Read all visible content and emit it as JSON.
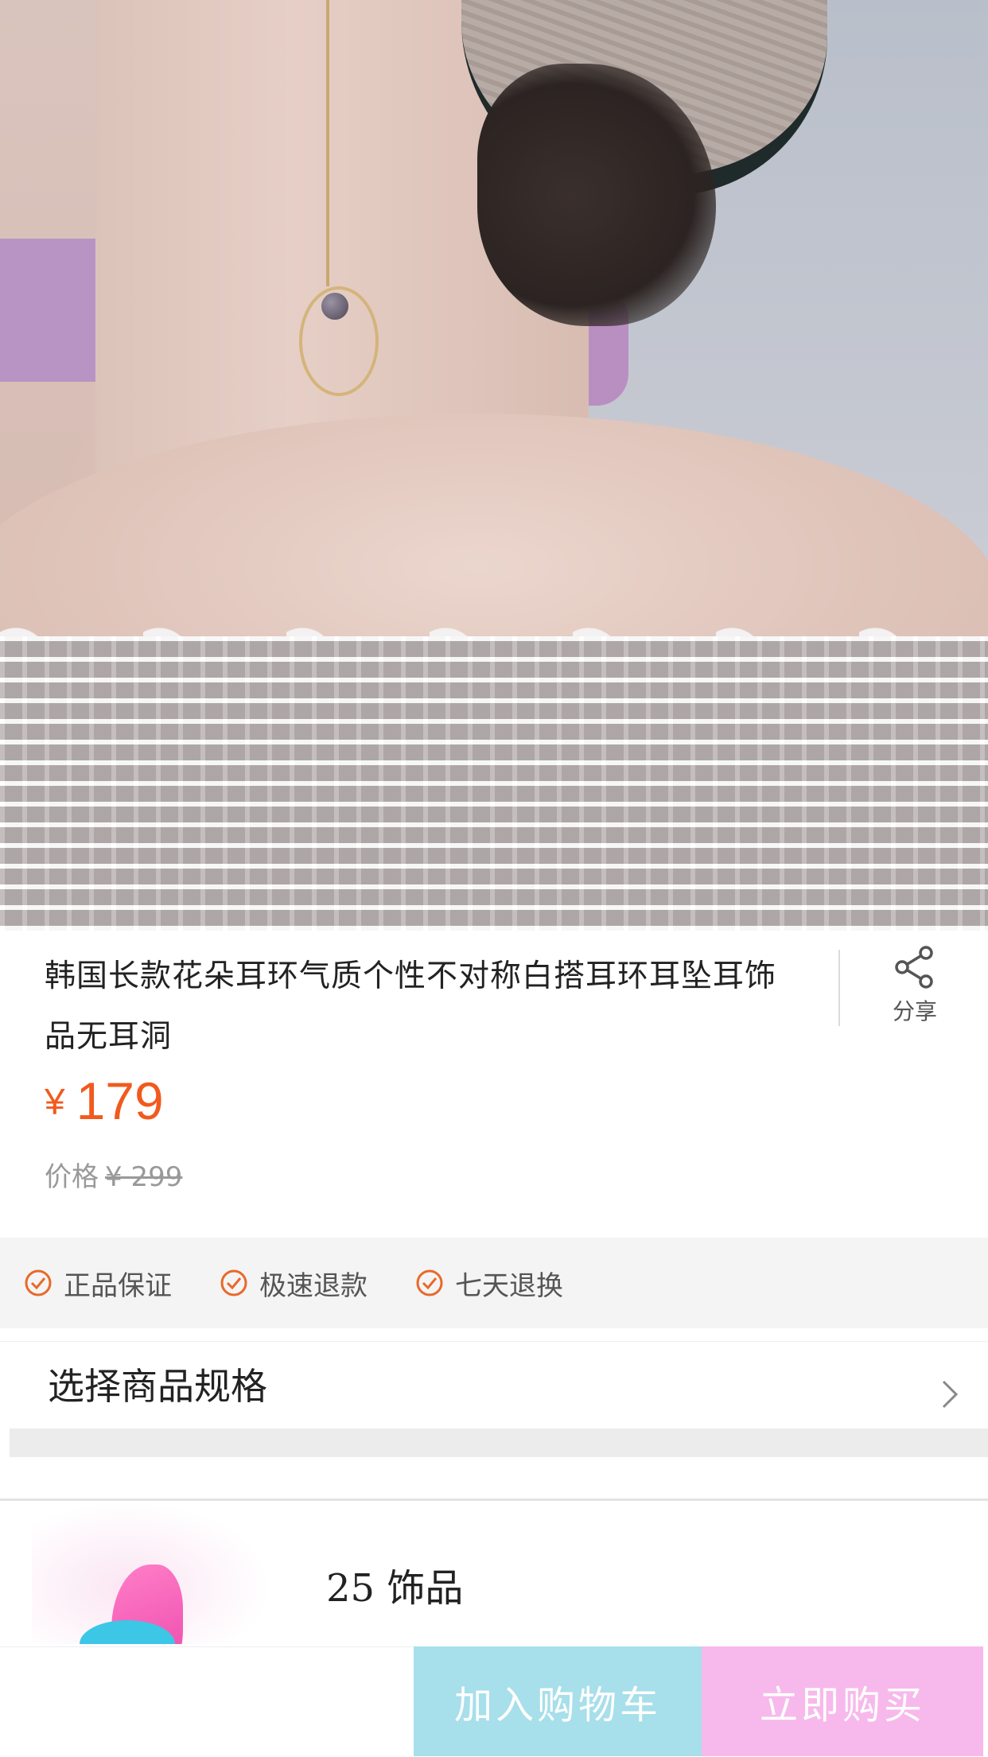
{
  "product": {
    "title": "韩国长款花朵耳环气质个性不对称白搭耳环耳坠耳饰品无耳洞",
    "currency_symbol": "¥",
    "price": "179",
    "original_price_label": "价格",
    "original_price": "¥ 299"
  },
  "share": {
    "label": "分享",
    "icon": "share-icon"
  },
  "guarantees": [
    {
      "label": "正品保证",
      "icon": "check-circle-icon"
    },
    {
      "label": "极速退款",
      "icon": "check-circle-icon"
    },
    {
      "label": "七天退换",
      "icon": "check-circle-icon"
    }
  ],
  "spec": {
    "label": "选择商品规格",
    "icon": "chevron-right-icon"
  },
  "store": {
    "name": "25 饰品"
  },
  "actions": {
    "add_to_cart": "加入购物车",
    "buy_now": "立即购买"
  },
  "colors": {
    "price": "#f15a1e",
    "guarantee_icon": "#e8692a",
    "cart_button": "#a7dfea",
    "buy_button": "#f7b9ec"
  }
}
